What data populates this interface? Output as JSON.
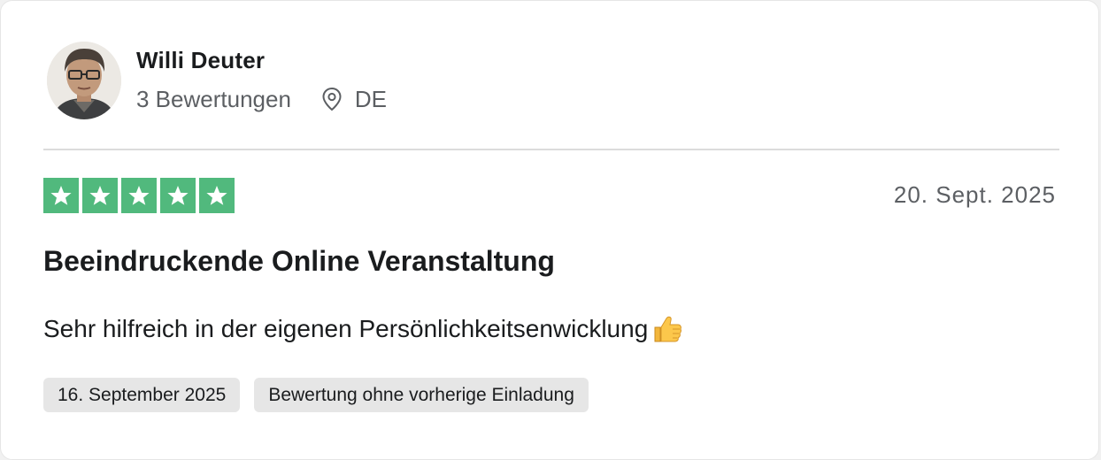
{
  "reviewer": {
    "name": "Willi Deuter",
    "reviews_count": "3 Bewertungen",
    "country": "DE"
  },
  "review": {
    "rating": 5,
    "rating_max": 5,
    "date": "20. Sept. 2025",
    "title": "Beeindruckende Online Veranstaltung",
    "body": "Sehr hilfreich in der eigenen Persönlichkeitsenwicklung",
    "tags": [
      "16. September 2025",
      "Bewertung ohne vorherige Einladung"
    ]
  },
  "icons": {
    "location": "location-pin-icon",
    "star": "star-icon",
    "thumbs_up": "thumbs-up-emoji"
  },
  "colors": {
    "star_green": "#51b97d",
    "text_primary": "#1a1c1e",
    "text_secondary": "#5c5f63",
    "tag_background": "#e6e6e6"
  }
}
